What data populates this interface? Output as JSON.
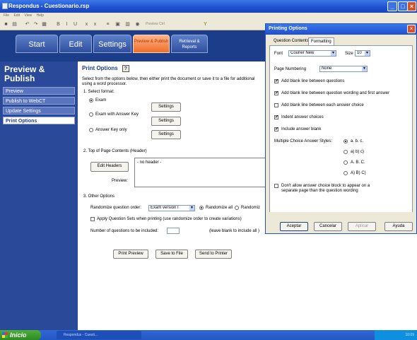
{
  "window": {
    "title": "Respondus - Cuestionario.rsp"
  },
  "menubar": [
    "File",
    "Edit",
    "View",
    "Help"
  ],
  "toolbar": {
    "preview_label": "Preview Ctrl",
    "icons": [
      "save-icon",
      "print-icon",
      "undo-icon",
      "redo-icon",
      "grid-icon",
      "bold-icon",
      "italic-icon",
      "underline-icon",
      "subscript-icon",
      "superscript-icon",
      "align-icon",
      "image-icon",
      "table-icon",
      "media-icon",
      "spell-icon",
      "equation-icon"
    ]
  },
  "nav_tabs": [
    {
      "label": "Start"
    },
    {
      "label": "Edit"
    },
    {
      "label": "Settings"
    },
    {
      "label": "Preview & Publish"
    },
    {
      "label": "Retrieval & Reports"
    }
  ],
  "sidebar": {
    "title": "Preview & Publish",
    "items": [
      {
        "label": "Preview"
      },
      {
        "label": "Publish to WebCT"
      },
      {
        "label": "Update Settings"
      },
      {
        "label": "Print Options"
      }
    ]
  },
  "main": {
    "title": "Print Options",
    "help_label": "?",
    "intro_line1": "Select from the options below, then either print the document or save it to a file for additional",
    "intro_line2": "using a word processor.",
    "section1": "1.  Select format:",
    "formats": [
      {
        "label": "Exam",
        "settings": "Settings",
        "selected": true
      },
      {
        "label": "Exam with Answer Key",
        "settings": "Settings",
        "selected": false
      },
      {
        "label": "Answer Key only",
        "settings": "Settings",
        "selected": false
      }
    ],
    "section2": "2.  Top of Page Contents (Header)",
    "edit_headers": "Edit Headers",
    "header_preview_text": "- no header -",
    "preview_label": "Preview:",
    "section3": "3.  Other Options",
    "randomize_label": "Randomize question order:",
    "randomize_value": "Exam version I",
    "randomize_all": "Randomize all",
    "randomize_partial": "Randomiz",
    "apply_sets": "Apply Question Sets when printing (use randomize order to create variations)",
    "num_questions_label": "Number of questions to be included:",
    "num_questions_hint": "(leave blank to include all )",
    "print_preview": "Print Preview",
    "save_to_file": "Save to File",
    "send_to_printer": "Send to Printer"
  },
  "dialog": {
    "title": "Printing Options",
    "close": "×",
    "tabs": [
      {
        "label": "Question Contents"
      },
      {
        "label": "Formatting"
      }
    ],
    "font_label": "Font",
    "font_value": "Courier New",
    "size_label": "Size",
    "size_value": "10",
    "page_numbering_label": "Page Numbering",
    "page_numbering_value": "None",
    "options": [
      {
        "label": "Add blank line between questions",
        "checked": true
      },
      {
        "label": "Add blank line between question wording and first answer",
        "checked": true
      },
      {
        "label": "Add blank line between each answer choice",
        "checked": false
      },
      {
        "label": "Indent answer choices",
        "checked": true
      },
      {
        "label": "Include answer blank",
        "checked": true
      }
    ],
    "mc_style_label": "Multiple Choice Answer Styles:",
    "mc_styles": [
      {
        "label": "a.  b.  c.",
        "selected": true
      },
      {
        "label": "a)  b)  c)",
        "selected": false
      },
      {
        "label": "A.  B.  C.",
        "selected": false
      },
      {
        "label": "A)  B)  C)",
        "selected": false
      }
    ],
    "no_split_line1": "Don't allow answer choice block to appear on a",
    "no_split_line2": "separate page than the question wording",
    "no_split_checked": false,
    "buttons": {
      "accept": "Aceptar",
      "cancel": "Cancelar",
      "apply": "Aplicar",
      "help": "Ayuda"
    }
  },
  "taskbar": {
    "start": "Inicio",
    "item": "Respondus - Cuesti...",
    "clock": "10:09"
  }
}
